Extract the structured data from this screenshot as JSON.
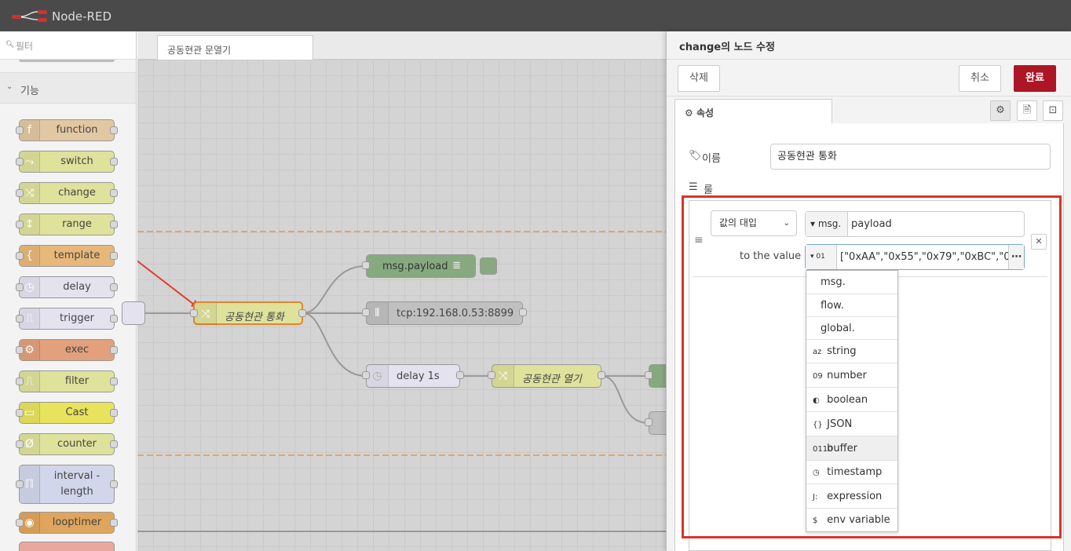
{
  "app": {
    "title": "Node-RED"
  },
  "palette": {
    "filter_placeholder": "필터",
    "category": "기능",
    "nodes": [
      {
        "label": "function",
        "color": "#e2c8a2",
        "icon": "f"
      },
      {
        "label": "switch",
        "color": "#dfe29b",
        "icon": "⤳"
      },
      {
        "label": "change",
        "color": "#dfe29b",
        "icon": "⤨"
      },
      {
        "label": "range",
        "color": "#dfe29b",
        "icon": "↕"
      },
      {
        "label": "template",
        "color": "#e8b87a",
        "icon": "{"
      },
      {
        "label": "delay",
        "color": "#e5e2f0",
        "icon": "◷"
      },
      {
        "label": "trigger",
        "color": "#e5e2f0",
        "icon": "⎍"
      },
      {
        "label": "exec",
        "color": "#e3a07c",
        "icon": "⚙"
      },
      {
        "label": "filter",
        "color": "#dfe29b",
        "icon": "⎍"
      },
      {
        "label": "Cast",
        "color": "#e8e35c",
        "icon": "▭"
      },
      {
        "label": "counter",
        "color": "#dfe29b",
        "icon": "Ø"
      },
      {
        "label": "interval -",
        "label2": "length",
        "color": "#d1d6ea",
        "icon": "ℿ"
      },
      {
        "label": "looptimer",
        "color": "#e0a55c",
        "icon": "◉"
      }
    ]
  },
  "workspace": {
    "tab": "공동현관 문열기",
    "nodes": {
      "change": "공동현관 통화",
      "debug": "msg.payload",
      "tcp": "tcp:192.168.0.53:8899",
      "delay": "delay 1s",
      "change2": "공동현관 열기"
    }
  },
  "editor": {
    "title": "change의 노드 수정",
    "delete": "삭제",
    "cancel": "취소",
    "done": "완료",
    "tab_properties": "속성",
    "name_label": "이름",
    "name_value": "공동현관 통화",
    "rules_label": "룰",
    "action": "값의 대입",
    "target_prefix": "msg.",
    "target_value": "payload",
    "to_label": "to the value",
    "value_type_icon": "01 10",
    "value": "[\"0xAA\",\"0x55\",\"0x79\",\"0xBC\",\"0x",
    "menu": [
      {
        "icon": "",
        "label": "msg."
      },
      {
        "icon": "",
        "label": "flow."
      },
      {
        "icon": "",
        "label": "global."
      },
      {
        "icon": "az",
        "label": "string"
      },
      {
        "icon": "09",
        "label": "number"
      },
      {
        "icon": "◐",
        "label": "boolean"
      },
      {
        "icon": "{}",
        "label": "JSON"
      },
      {
        "icon": "0110",
        "label": "buffer"
      },
      {
        "icon": "◷",
        "label": "timestamp"
      },
      {
        "icon": "J:",
        "label": "expression"
      },
      {
        "icon": "$",
        "label": "env variable"
      }
    ]
  },
  "colors": {
    "done": "#ad1625",
    "highlight": "#d9342b"
  }
}
